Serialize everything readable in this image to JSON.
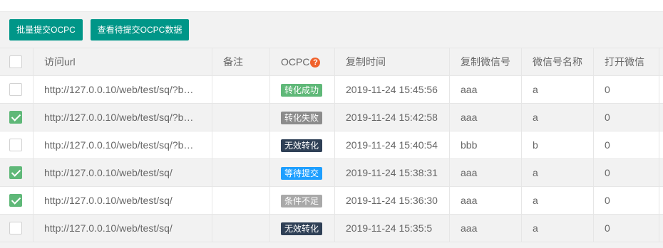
{
  "toolbar": {
    "batch_submit_label": "批量提交OCPC",
    "view_pending_label": "查看待提交OCPC数据"
  },
  "table": {
    "columns": [
      "访问url",
      "备注",
      "OCPC",
      "复制时间",
      "复制微信号",
      "微信号名称",
      "打开微信"
    ],
    "ocpc_help_icon": "question-circle-icon",
    "rows": [
      {
        "checked": false,
        "url": "http://127.0.0.10/web/test/sq/?bd_vid=...",
        "note": "",
        "status": "转化成功",
        "status_color": "#5fb878",
        "time": "2019-11-24 15:45:56",
        "wechat_id": "aaa",
        "wechat_name": "a",
        "open": "0"
      },
      {
        "checked": true,
        "url": "http://127.0.0.10/web/test/sq/?bd_vid=...",
        "note": "",
        "status": "转化失败",
        "status_color": "#8c8c8c",
        "time": "2019-11-24 15:42:58",
        "wechat_id": "aaa",
        "wechat_name": "a",
        "open": "0"
      },
      {
        "checked": false,
        "url": "http://127.0.0.10/web/test/sq/?bd_vid=...",
        "note": "",
        "status": "无效转化",
        "status_color": "#2f4056",
        "time": "2019-11-24 15:40:54",
        "wechat_id": "bbb",
        "wechat_name": "b",
        "open": "0"
      },
      {
        "checked": true,
        "url": "http://127.0.0.10/web/test/sq/",
        "note": "",
        "status": "等待提交",
        "status_color": "#1e9fff",
        "time": "2019-11-24 15:38:31",
        "wechat_id": "aaa",
        "wechat_name": "a",
        "open": "0"
      },
      {
        "checked": true,
        "url": "http://127.0.0.10/web/test/sq/",
        "note": "",
        "status": "条件不足",
        "status_color": "#a9a9a9",
        "time": "2019-11-24 15:36:30",
        "wechat_id": "aaa",
        "wechat_name": "a",
        "open": "0"
      },
      {
        "checked": false,
        "url": "http://127.0.0.10/web/test/sq/",
        "note": "",
        "status": "无效转化",
        "status_color": "#2f4056",
        "time": "2019-11-24 15:35:5",
        "wechat_id": "aaa",
        "wechat_name": "a",
        "open": "0"
      }
    ]
  }
}
